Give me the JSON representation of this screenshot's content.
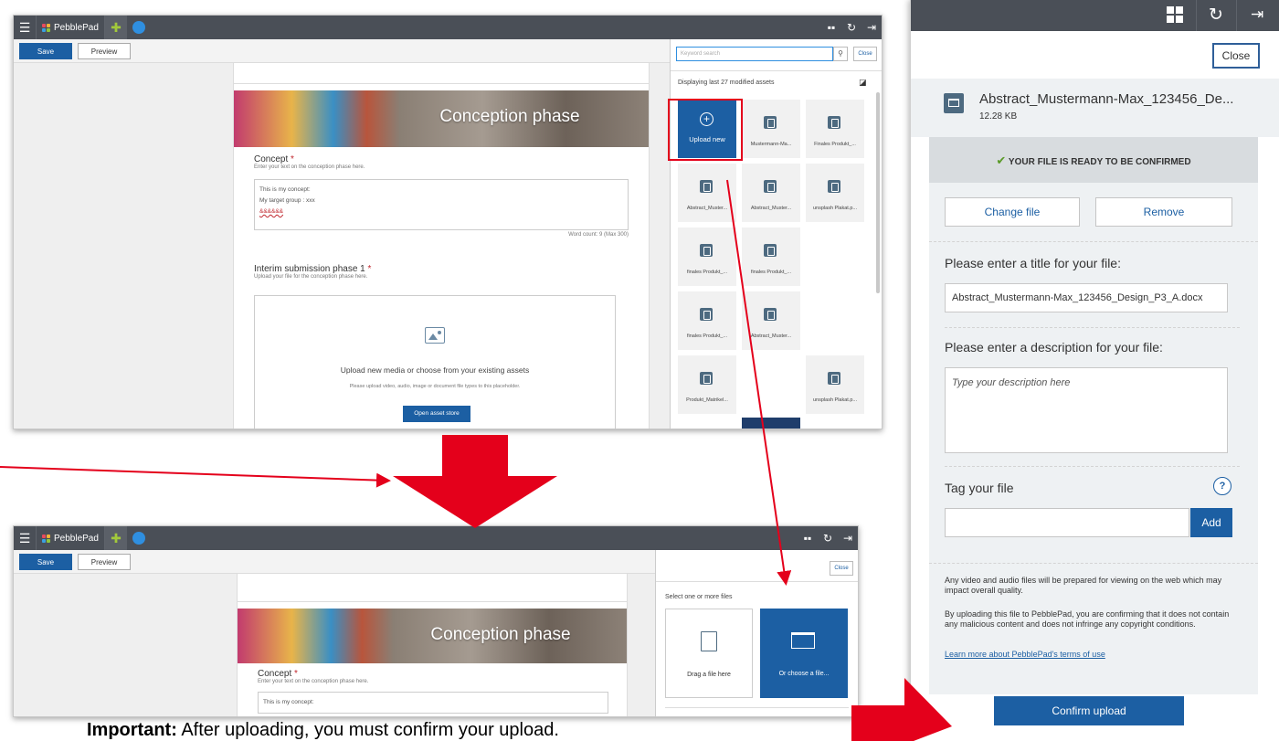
{
  "app": {
    "brand": "PebblePad",
    "save_label": "Save",
    "preview_label": "Preview"
  },
  "editor": {
    "banner_title": "Conception phase",
    "concept": {
      "title": "Concept",
      "required_mark": "*",
      "hint": "Enter your text on the conception phase here.",
      "lines": [
        "This is my concept:",
        "My target group : xxx",
        "&&&&&&"
      ],
      "word_count": "Word count: 9 (Max 300)"
    },
    "interim": {
      "title": "Interim submission phase 1",
      "required_mark": "*",
      "hint": "Upload your file for the conception phase here.",
      "upload_text": "Upload new media or choose from your existing assets",
      "upload_hint": "Please upload video, audio, image or document file types to this placeholder.",
      "open_asset_store": "Open asset store"
    }
  },
  "asset_panel": {
    "search_placeholder": "Keyword search",
    "close_label": "Close",
    "displaying": "Displaying last 27 modified assets",
    "upload_new": "Upload new",
    "tiles": [
      "Mustermann-Ma...",
      "Finales Produkt_...",
      "Abstract_Muster...",
      "Abstract_Muster...",
      "unsplash Plakat.p...",
      "finales Produkt_...",
      "finales Produkt_...",
      "finales Produkt_...",
      "Abstract_Muster...",
      "Produkt_Matrikel...",
      "unsplash Plakat.p..."
    ]
  },
  "select_panel": {
    "close_label": "Close",
    "select_text": "Select one or more files",
    "drag_label": "Drag a file here",
    "choose_label": "Or choose a file..."
  },
  "confirm_panel": {
    "close_label": "Close",
    "file_name": "Abstract_Mustermann-Max_123456_De...",
    "file_size": "12.28 KB",
    "ready_text": "YOUR FILE IS READY TO BE CONFIRMED",
    "change_file": "Change file",
    "remove": "Remove",
    "title_label": "Please enter a title for your file:",
    "title_value": "Abstract_Mustermann-Max_123456_Design_P3_A.docx",
    "description_label": "Please enter a description for your file:",
    "description_placeholder": "Type your description here",
    "tag_label": "Tag your file",
    "help_symbol": "?",
    "add_label": "Add",
    "notice_video": "Any video and audio files will be prepared for viewing on the web which may impact overall quality.",
    "notice_copyright": "By uploading this file to PebblePad, you are confirming that it does not contain any malicious content and does not infringe any copyright conditions.",
    "terms_link": "Learn more about PebblePad's terms of use",
    "confirm_upload": "Confirm upload"
  },
  "caption": {
    "bold": "Important:",
    "text": " After uploading, you must confirm your upload."
  },
  "colors": {
    "brand_blue": "#1c5fa3",
    "topbar": "#4a4f57",
    "arrow_red": "#e4001b",
    "ready_green": "#5a9a28"
  }
}
